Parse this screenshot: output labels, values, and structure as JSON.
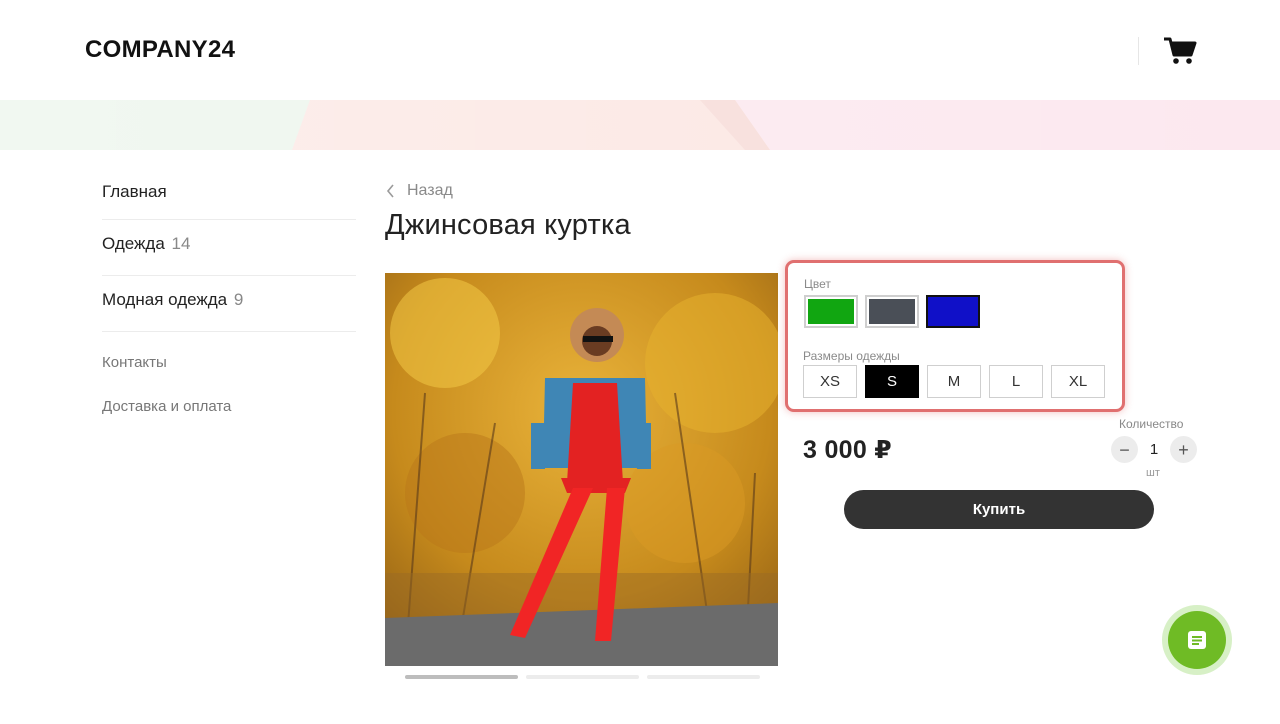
{
  "header": {
    "logo": "COMPANY24",
    "cart_icon": "cart-icon"
  },
  "sidebar": {
    "items": [
      {
        "label": "Главная",
        "count": ""
      },
      {
        "label": "Одежда",
        "count": "14"
      },
      {
        "label": "Модная одежда",
        "count": "9"
      }
    ],
    "links": [
      {
        "label": "Контакты"
      },
      {
        "label": "Доставка и оплата"
      }
    ]
  },
  "product": {
    "back_label": "Назад",
    "title": "Джинсовая куртка",
    "gallery_slides": 3,
    "gallery_active": 1,
    "options": {
      "color_label": "Цвет",
      "colors": [
        "#11a611",
        "#4a4f57",
        "#1010c8"
      ],
      "selected_color": 2,
      "size_label": "Размеры одежды",
      "sizes": [
        "XS",
        "S",
        "M",
        "L",
        "XL"
      ],
      "selected_size": 1
    },
    "price": "3 000 ₽",
    "quantity_label": "Количество",
    "quantity": "1",
    "quantity_unit": "шт",
    "minus": "−",
    "plus": "+",
    "buy_label": "Купить"
  },
  "fab": {
    "icon": "document-icon",
    "color": "#6fbb25"
  }
}
